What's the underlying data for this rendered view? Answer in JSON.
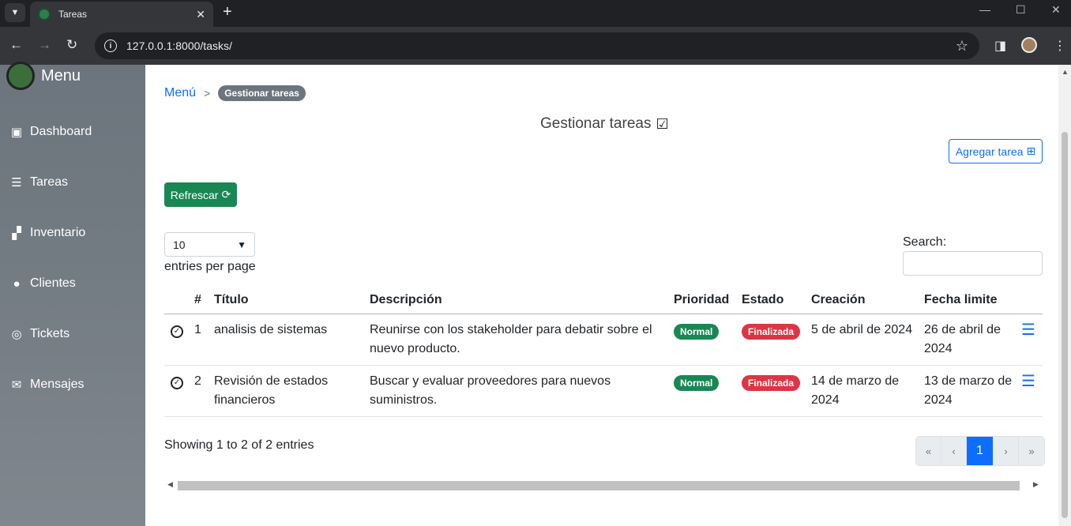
{
  "browser": {
    "tab_title": "Tareas",
    "url": "127.0.0.1:8000/tasks/",
    "new_tab": "+",
    "close_tab": "✕"
  },
  "sidebar": {
    "brand": "Menu",
    "items": [
      {
        "label": "Dashboard",
        "icon": "dashboard-icon"
      },
      {
        "label": "Tareas",
        "icon": "tasks-icon"
      },
      {
        "label": "Inventario",
        "icon": "boxes-icon"
      },
      {
        "label": "Clientes",
        "icon": "users-icon"
      },
      {
        "label": "Tickets",
        "icon": "headset-icon"
      },
      {
        "label": "Mensajes",
        "icon": "envelope-icon"
      }
    ]
  },
  "breadcrumb": {
    "home": "Menú",
    "separator": ">",
    "current": "Gestionar tareas"
  },
  "page": {
    "title": "Gestionar tareas",
    "add_button": "Agregar tarea",
    "refresh_button": "Refrescar"
  },
  "datatable": {
    "page_size": "10",
    "entries_label": "entries per page",
    "search_label": "Search:",
    "columns": [
      "",
      "#",
      "Título",
      "Descripción",
      "Prioridad",
      "Estado",
      "Creación",
      "Fecha limite",
      ""
    ],
    "rows": [
      {
        "num": "1",
        "title": "analisis de sistemas",
        "description": "Reunirse con los stakeholder para debatir sobre el nuevo producto.",
        "priority": "Normal",
        "status": "Finalizada",
        "created": "5 de abril de 2024",
        "deadline": "26 de abril de 2024"
      },
      {
        "num": "2",
        "title": "Revisión de estados financieros",
        "description": "Buscar y evaluar proveedores para nuevos suministros.",
        "priority": "Normal",
        "status": "Finalizada",
        "created": "14 de marzo de 2024",
        "deadline": "13 de marzo de 2024"
      }
    ],
    "info": "Showing 1 to 2 of 2 entries",
    "pagination": {
      "first": "«",
      "prev": "‹",
      "current": "1",
      "next": "›",
      "last": "»"
    }
  },
  "colors": {
    "primary": "#0d6efd",
    "success": "#198754",
    "danger": "#dc3545",
    "secondary": "#6c757d"
  }
}
